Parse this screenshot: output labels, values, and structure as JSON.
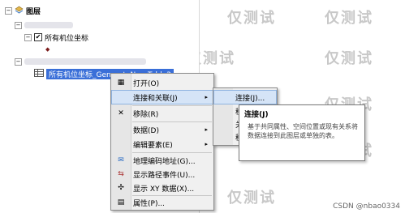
{
  "watermark": "仅测试",
  "tree": {
    "root_label": "图层",
    "layer1_label": "所有机位坐标",
    "layer2_label": "所有机位坐标_GenerateNearTable2"
  },
  "context_menu": {
    "items": [
      {
        "icon": "table-icon",
        "label": "打开(O)"
      },
      {
        "icon": "join-icon",
        "label": "连接和关联(J)",
        "arrow": "▸"
      },
      {
        "icon": "remove-icon",
        "label": "移除(R)"
      },
      {
        "icon": "",
        "label": "数据(D)",
        "arrow": "▸"
      },
      {
        "icon": "",
        "label": "编辑要素(E)",
        "arrow": "▸"
      },
      {
        "icon": "geocode-icon",
        "label": "地理编码地址(G)..."
      },
      {
        "icon": "route-icon",
        "label": "显示路径事件(U)..."
      },
      {
        "icon": "xy-icon",
        "label": "显示 XY 数据(X)..."
      },
      {
        "icon": "properties-icon",
        "label": "属性(P)..."
      }
    ]
  },
  "submenu": {
    "items": [
      {
        "label": "连接(J)..."
      },
      {
        "label": "移"
      },
      {
        "label": "关"
      },
      {
        "label": "移"
      }
    ]
  },
  "tooltip": {
    "title": "连接(J)",
    "description": "基于共同属性、空间位置或现有关系将数据连接到此图层或单独的表。"
  },
  "footer": {
    "credit": "CSDN @nbao0334"
  }
}
